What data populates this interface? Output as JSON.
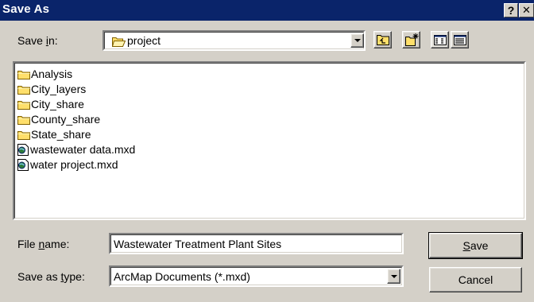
{
  "window": {
    "title": "Save As",
    "help_button": "?",
    "close_button": "✕"
  },
  "look_in": {
    "label_pre": "Save ",
    "label_hotkey": "i",
    "label_post": "n:",
    "value": "project"
  },
  "toolbar": {
    "icons": [
      "up-one-level-icon",
      "create-new-folder-icon",
      "list-view-icon",
      "details-view-icon"
    ]
  },
  "files": [
    {
      "name": "Analysis",
      "type": "folder"
    },
    {
      "name": "City_layers",
      "type": "folder"
    },
    {
      "name": "City_share",
      "type": "folder"
    },
    {
      "name": "County_share",
      "type": "folder"
    },
    {
      "name": "State_share",
      "type": "folder"
    },
    {
      "name": "wastewater data.mxd",
      "type": "map-document"
    },
    {
      "name": "water project.mxd",
      "type": "map-document"
    }
  ],
  "file_name": {
    "label_pre": "File ",
    "label_hotkey": "n",
    "label_post": "ame:",
    "value": "Wastewater Treatment Plant Sites"
  },
  "save_as_type": {
    "label_pre": "Save as ",
    "label_hotkey": "t",
    "label_post": "ype:",
    "value": "ArcMap Documents (*.mxd)"
  },
  "buttons": {
    "save_hotkey": "S",
    "save_rest": "ave",
    "cancel": "Cancel"
  },
  "colors": {
    "title_bar": "#0a246a",
    "dialog_face": "#d4d0c8",
    "folder_yellow": "#ffdf6b"
  }
}
